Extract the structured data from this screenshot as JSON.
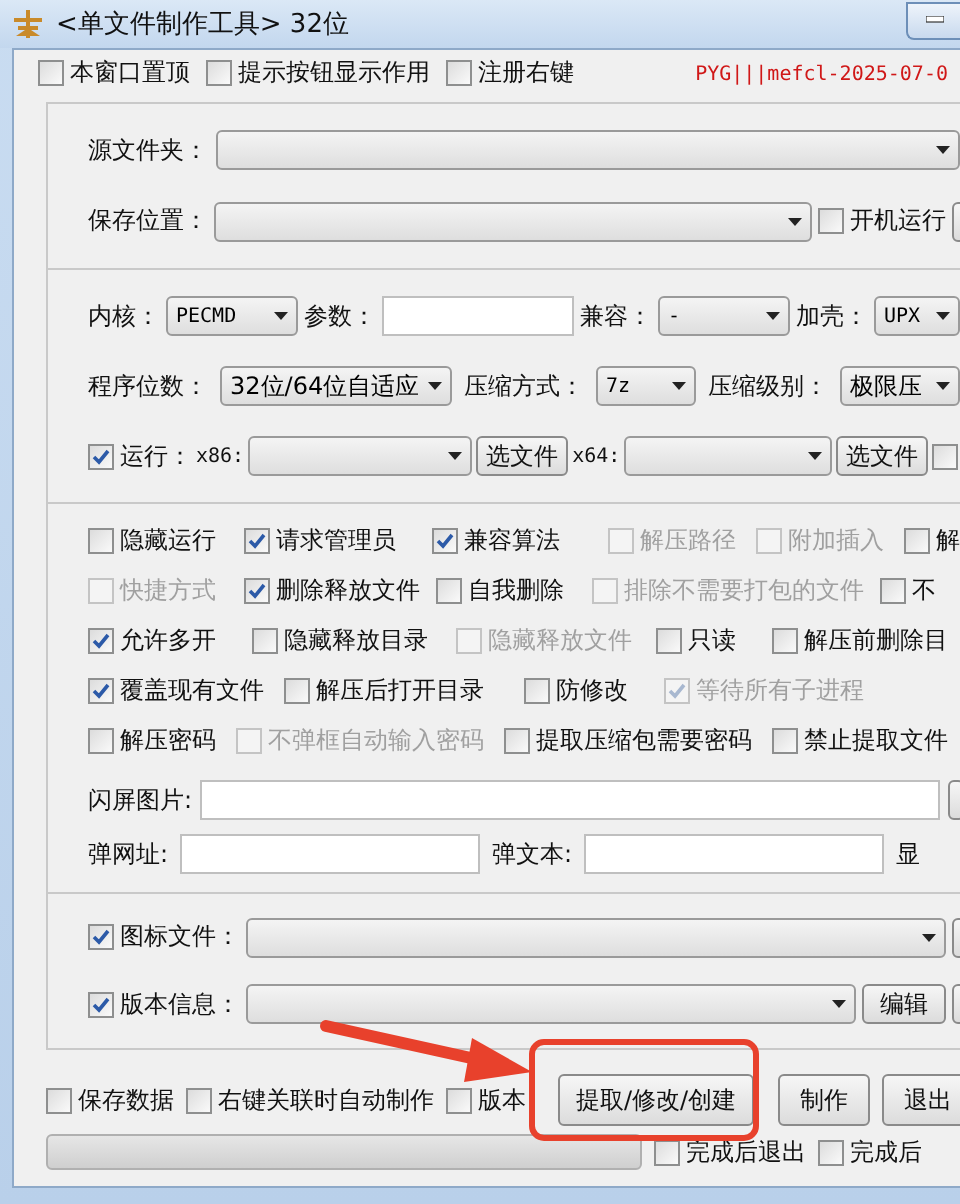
{
  "window": {
    "title": "<单文件制作工具> 32位"
  },
  "top_options": [
    {
      "label": "本窗口置顶",
      "checked": false
    },
    {
      "label": "提示按钮显示作用",
      "checked": false
    },
    {
      "label": "注册右键",
      "checked": false
    }
  ],
  "license_text": "PYG|||mefcl-2025-07-0",
  "source_folder": {
    "label": "源文件夹："
  },
  "save_location": {
    "label": "保存位置：",
    "autostart": {
      "label": "开机运行",
      "checked": false
    }
  },
  "engine": {
    "label": "内核：",
    "value": "PECMD"
  },
  "params": {
    "label": "参数："
  },
  "compat": {
    "label": "兼容：",
    "value": "-"
  },
  "packer": {
    "label": "加壳：",
    "value": "UPX"
  },
  "bitness": {
    "label": "程序位数：",
    "value": "32位/64位自适应"
  },
  "compression": {
    "label": "压缩方式：",
    "value": "7z"
  },
  "compression_level": {
    "label": "压缩级别：",
    "value": "极限压"
  },
  "run": {
    "label": "运行：",
    "checked": true,
    "x86_label": "x86:",
    "x64_label": "x64:",
    "browse_x86": "选文件",
    "browse_x64": "选文件",
    "extra": {
      "checked": false
    }
  },
  "options": [
    [
      {
        "label": "隐藏运行",
        "checked": false,
        "disabled": false
      },
      {
        "label": "请求管理员",
        "checked": true,
        "disabled": false
      },
      {
        "label": "兼容算法",
        "checked": true,
        "disabled": false
      },
      {
        "label": "解压路径",
        "checked": false,
        "disabled": true
      },
      {
        "label": "附加插入",
        "checked": false,
        "disabled": true
      },
      {
        "label": "解",
        "checked": false,
        "disabled": false
      }
    ],
    [
      {
        "label": "快捷方式",
        "checked": false,
        "disabled": true
      },
      {
        "label": "删除释放文件",
        "checked": true,
        "disabled": false
      },
      {
        "label": "自我删除",
        "checked": false,
        "disabled": false
      },
      {
        "label": "排除不需要打包的文件",
        "checked": false,
        "disabled": true
      },
      {
        "label": "不",
        "checked": false,
        "disabled": false
      }
    ],
    [
      {
        "label": "允许多开",
        "checked": true,
        "disabled": false
      },
      {
        "label": "隐藏释放目录",
        "checked": false,
        "disabled": false
      },
      {
        "label": "隐藏释放文件",
        "checked": false,
        "disabled": true
      },
      {
        "label": "只读",
        "checked": false,
        "disabled": false
      },
      {
        "label": "解压前删除目",
        "checked": false,
        "disabled": false
      }
    ],
    [
      {
        "label": "覆盖现有文件",
        "checked": true,
        "disabled": false
      },
      {
        "label": "解压后打开目录",
        "checked": false,
        "disabled": false
      },
      {
        "label": "防修改",
        "checked": false,
        "disabled": false
      },
      {
        "label": "等待所有子进程",
        "checked": true,
        "disabled": true
      }
    ],
    [
      {
        "label": "解压密码",
        "checked": false,
        "disabled": false
      },
      {
        "label": "不弹框自动输入密码",
        "checked": false,
        "disabled": true
      },
      {
        "label": "提取压缩包需要密码",
        "checked": false,
        "disabled": false
      },
      {
        "label": "禁止提取文件",
        "checked": false,
        "disabled": false
      }
    ]
  ],
  "splash": {
    "label": "闪屏图片:"
  },
  "popup_url": {
    "label": "弹网址:"
  },
  "popup_text": {
    "label": "弹文本:"
  },
  "show_label": "显",
  "icon_file": {
    "label": "图标文件：",
    "checked": true
  },
  "version_info": {
    "label": "版本信息：",
    "checked": true,
    "button": "编辑"
  },
  "bottom_options": [
    {
      "label": "保存数据",
      "checked": false
    },
    {
      "label": "右键关联时自动制作",
      "checked": false
    },
    {
      "label": "版本",
      "checked": false
    }
  ],
  "buttons": [
    {
      "label": "提取/修改/创建"
    },
    {
      "label": "制作"
    },
    {
      "label": "退出"
    }
  ],
  "progress": {
    "level": 0
  },
  "finish_options": [
    {
      "label": "完成后退出",
      "checked": false
    },
    {
      "label": "完成后",
      "checked": false
    }
  ]
}
